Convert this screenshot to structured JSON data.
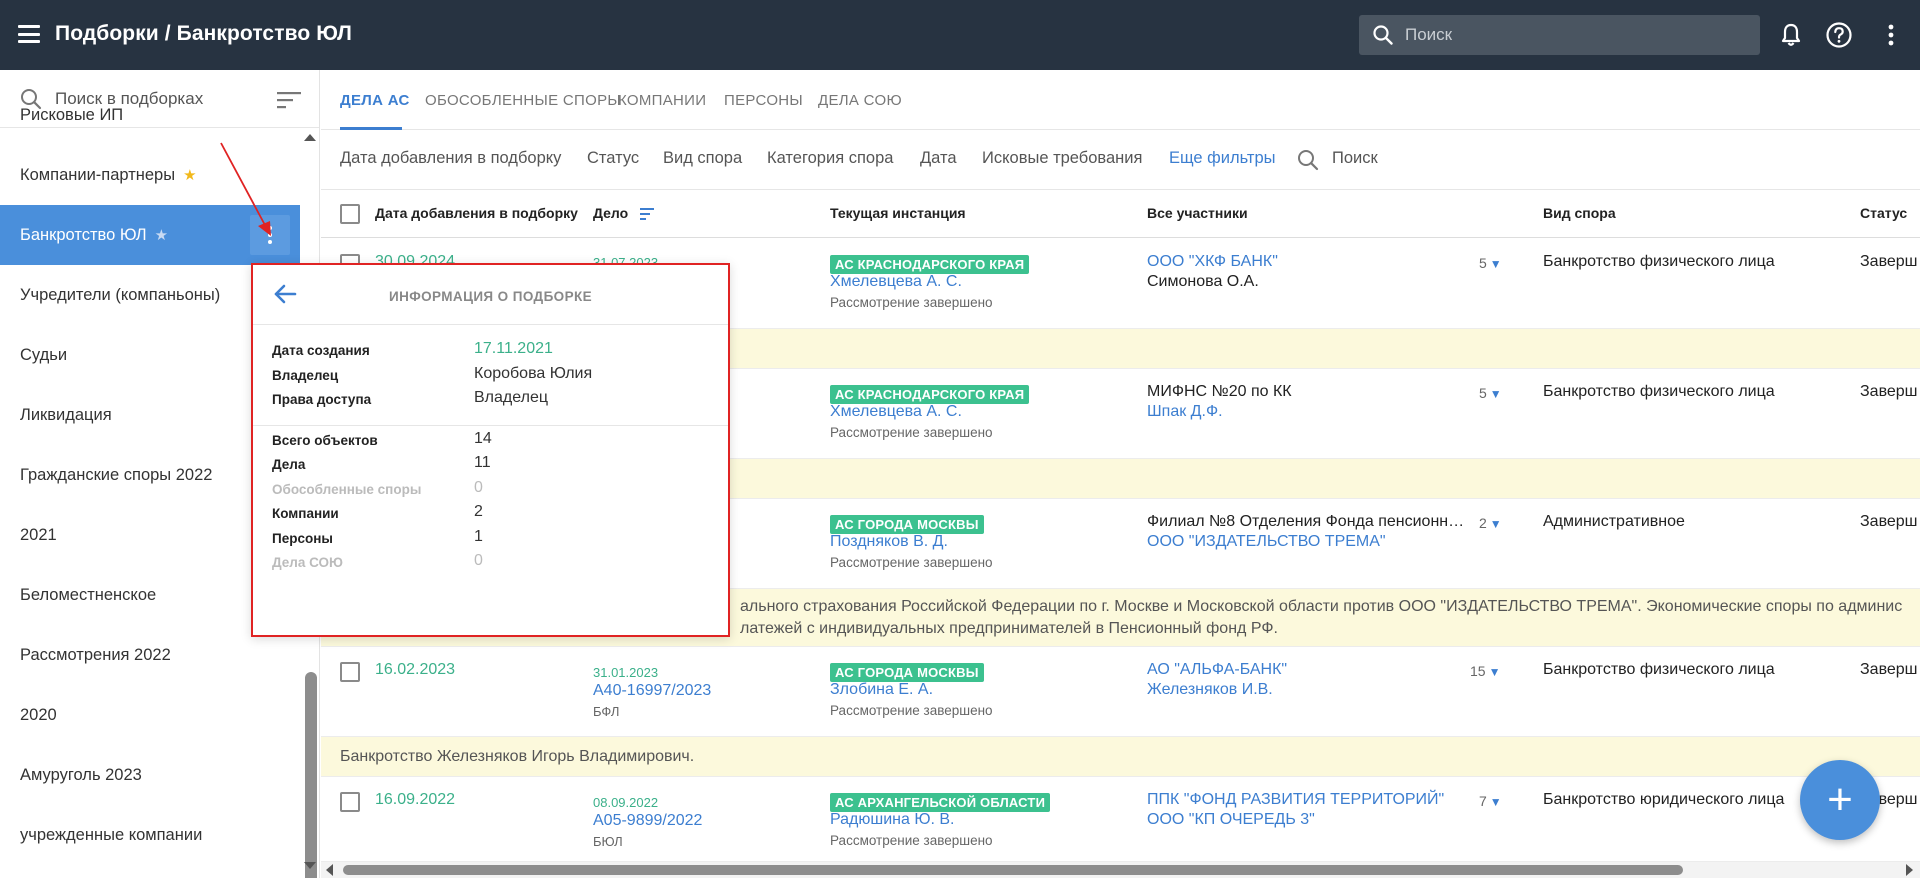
{
  "header": {
    "title": "Подборки / Банкротство ЮЛ",
    "search_placeholder": "Поиск"
  },
  "sidebar": {
    "search_label": "Поиск в подборках",
    "items": [
      {
        "label": "Рисковые ИП",
        "star": false
      },
      {
        "label": "Компании-партнеры",
        "star": "gold"
      },
      {
        "label": "Банкротство ЮЛ",
        "star": "white",
        "active": true
      },
      {
        "label": "Учредители (компаньоны)"
      },
      {
        "label": "Судьи"
      },
      {
        "label": "Ликвидация"
      },
      {
        "label": "Гражданские споры 2022"
      },
      {
        "label": "2021"
      },
      {
        "label": "Беломестненское"
      },
      {
        "label": "Рассмотрения 2022"
      },
      {
        "label": "2020"
      },
      {
        "label": "Амуруголь 2023"
      },
      {
        "label": "учрежденные компании"
      }
    ]
  },
  "tabs": [
    {
      "label": "ДЕЛА АС",
      "active": true
    },
    {
      "label": "ОБОСОБЛЕННЫЕ СПОРЫ"
    },
    {
      "label": "КОМПАНИИ"
    },
    {
      "label": "ПЕРСОНЫ"
    },
    {
      "label": "ДЕЛА СОЮ"
    }
  ],
  "filters": {
    "items": [
      "Дата добавления в подборку",
      "Статус",
      "Вид спора",
      "Категория спора",
      "Дата",
      "Исковые требования"
    ],
    "more": "Еще фильтры",
    "search": "Поиск"
  },
  "table": {
    "headers": [
      "Дата добавления в подборку",
      "Дело",
      "Текущая инстанция",
      "Все участники",
      "Вид спора",
      "Статус"
    ],
    "rows": [
      {
        "added": "30.09.2024",
        "case_date": "31.07.2023",
        "case_num": "",
        "case_type": "",
        "badge": "АС КРАСНОДАРСКОГО КРАЯ",
        "judge": "Хмелевцева А. С.",
        "inst_status": "Рассмотрение завершено",
        "party1": "ООО \"ХКФ БАНК\"",
        "party2": "Симонова О.А.",
        "count": "5",
        "dispute": "Банкротство физического лица",
        "status": "Заверш"
      },
      {
        "added": "",
        "case_date": "",
        "case_num": "",
        "case_type": "",
        "badge": "АС КРАСНОДАРСКОГО КРАЯ",
        "judge": "Хмелевцева А. С.",
        "inst_status": "Рассмотрение завершено",
        "party1": "МИФНС №20 по КК",
        "party2": "Шпак Д.Ф.",
        "count": "5",
        "dispute": "Банкротство физического лица",
        "status": "Заверш"
      },
      {
        "added": "",
        "case_date": "",
        "case_num": "",
        "case_type": "",
        "badge": "АС ГОРОДА МОСКВЫ",
        "judge": "Поздняков В. Д.",
        "inst_status": "Рассмотрение завершено",
        "party1": "Филиал №8 Отделения Фонда пенсионн…",
        "party2": "ООО \"ИЗДАТЕЛЬСТВО ТРЕМА\"",
        "count": "2",
        "dispute": "Административное",
        "status": "Заверш"
      },
      {
        "added": "16.02.2023",
        "case_date": "31.01.2023",
        "case_num": "А40-16997/2023",
        "case_type": "БФЛ",
        "badge": "АС ГОРОДА МОСКВЫ",
        "judge": "Злобина Е. А.",
        "inst_status": "Рассмотрение завершено",
        "party1": "АО \"АЛЬФА-БАНК\"",
        "party2": "Железняков И.В.",
        "count": "15",
        "dispute": "Банкротство физического лица",
        "status": "Заверш"
      },
      {
        "added": "16.09.2022",
        "case_date": "08.09.2022",
        "case_num": "А05-9899/2022",
        "case_type": "БЮЛ",
        "badge": "АС АРХАНГЕЛЬСКОЙ ОБЛАСТИ",
        "judge": "Радюшина Ю. В.",
        "inst_status": "Рассмотрение завершено",
        "party1": "ППК \"ФОНД РАЗВИТИЯ ТЕРРИТОРИЙ\"",
        "party2": "ООО \"КП ОЧЕРЕДЬ 3\"",
        "count": "7",
        "dispute": "Банкротство юридического лица",
        "status": "Заверш"
      }
    ],
    "notes": {
      "n3_line1": "ального страхования Российской Федерации по г. Москве и Московской области против ООО \"ИЗДАТЕЛЬСТВО ТРЕМА\". Экономические споры по админис",
      "n3_line2": "латежей с индивидуальных предпринимателей в Пенсионный фонд РФ.",
      "n4": "Банкротство Железняков Игорь Владимирович."
    }
  },
  "popup": {
    "title": "ИНФОРМАЦИЯ О ПОДБОРКЕ",
    "created_label": "Дата создания",
    "created_value": "17.11.2021",
    "owner_label": "Владелец",
    "owner_value": "Коробова Юлия",
    "access_label": "Права доступа",
    "access_value": "Владелец",
    "total_label": "Всего объектов",
    "total_value": "14",
    "cases_label": "Дела",
    "cases_value": "11",
    "disputes_label": "Обособленные споры",
    "disputes_value": "0",
    "companies_label": "Компании",
    "companies_value": "2",
    "persons_label": "Персоны",
    "persons_value": "1",
    "soyu_label": "Дела СОЮ",
    "soyu_value": "0"
  },
  "fab_label": "+",
  "colors": {
    "topbar": "#273341",
    "accent": "#4a8fdb",
    "green": "#3bb08a",
    "badge": "#3cc18f",
    "note_bg": "#fcf9dc",
    "popup_border": "#e02323"
  }
}
